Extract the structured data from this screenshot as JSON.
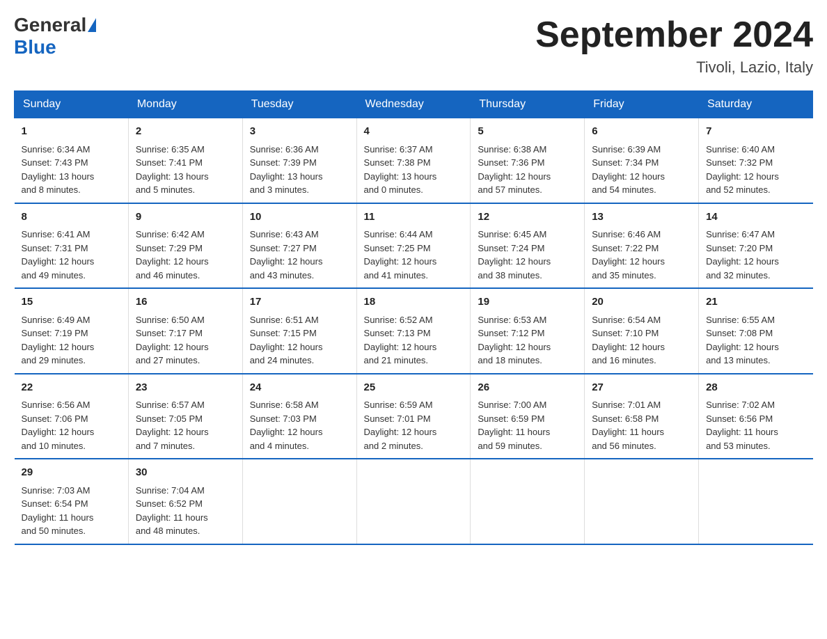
{
  "header": {
    "title": "September 2024",
    "location": "Tivoli, Lazio, Italy",
    "logo_general": "General",
    "logo_blue": "Blue"
  },
  "days_of_week": [
    "Sunday",
    "Monday",
    "Tuesday",
    "Wednesday",
    "Thursday",
    "Friday",
    "Saturday"
  ],
  "weeks": [
    [
      {
        "day": "1",
        "info": "Sunrise: 6:34 AM\nSunset: 7:43 PM\nDaylight: 13 hours\nand 8 minutes."
      },
      {
        "day": "2",
        "info": "Sunrise: 6:35 AM\nSunset: 7:41 PM\nDaylight: 13 hours\nand 5 minutes."
      },
      {
        "day": "3",
        "info": "Sunrise: 6:36 AM\nSunset: 7:39 PM\nDaylight: 13 hours\nand 3 minutes."
      },
      {
        "day": "4",
        "info": "Sunrise: 6:37 AM\nSunset: 7:38 PM\nDaylight: 13 hours\nand 0 minutes."
      },
      {
        "day": "5",
        "info": "Sunrise: 6:38 AM\nSunset: 7:36 PM\nDaylight: 12 hours\nand 57 minutes."
      },
      {
        "day": "6",
        "info": "Sunrise: 6:39 AM\nSunset: 7:34 PM\nDaylight: 12 hours\nand 54 minutes."
      },
      {
        "day": "7",
        "info": "Sunrise: 6:40 AM\nSunset: 7:32 PM\nDaylight: 12 hours\nand 52 minutes."
      }
    ],
    [
      {
        "day": "8",
        "info": "Sunrise: 6:41 AM\nSunset: 7:31 PM\nDaylight: 12 hours\nand 49 minutes."
      },
      {
        "day": "9",
        "info": "Sunrise: 6:42 AM\nSunset: 7:29 PM\nDaylight: 12 hours\nand 46 minutes."
      },
      {
        "day": "10",
        "info": "Sunrise: 6:43 AM\nSunset: 7:27 PM\nDaylight: 12 hours\nand 43 minutes."
      },
      {
        "day": "11",
        "info": "Sunrise: 6:44 AM\nSunset: 7:25 PM\nDaylight: 12 hours\nand 41 minutes."
      },
      {
        "day": "12",
        "info": "Sunrise: 6:45 AM\nSunset: 7:24 PM\nDaylight: 12 hours\nand 38 minutes."
      },
      {
        "day": "13",
        "info": "Sunrise: 6:46 AM\nSunset: 7:22 PM\nDaylight: 12 hours\nand 35 minutes."
      },
      {
        "day": "14",
        "info": "Sunrise: 6:47 AM\nSunset: 7:20 PM\nDaylight: 12 hours\nand 32 minutes."
      }
    ],
    [
      {
        "day": "15",
        "info": "Sunrise: 6:49 AM\nSunset: 7:19 PM\nDaylight: 12 hours\nand 29 minutes."
      },
      {
        "day": "16",
        "info": "Sunrise: 6:50 AM\nSunset: 7:17 PM\nDaylight: 12 hours\nand 27 minutes."
      },
      {
        "day": "17",
        "info": "Sunrise: 6:51 AM\nSunset: 7:15 PM\nDaylight: 12 hours\nand 24 minutes."
      },
      {
        "day": "18",
        "info": "Sunrise: 6:52 AM\nSunset: 7:13 PM\nDaylight: 12 hours\nand 21 minutes."
      },
      {
        "day": "19",
        "info": "Sunrise: 6:53 AM\nSunset: 7:12 PM\nDaylight: 12 hours\nand 18 minutes."
      },
      {
        "day": "20",
        "info": "Sunrise: 6:54 AM\nSunset: 7:10 PM\nDaylight: 12 hours\nand 16 minutes."
      },
      {
        "day": "21",
        "info": "Sunrise: 6:55 AM\nSunset: 7:08 PM\nDaylight: 12 hours\nand 13 minutes."
      }
    ],
    [
      {
        "day": "22",
        "info": "Sunrise: 6:56 AM\nSunset: 7:06 PM\nDaylight: 12 hours\nand 10 minutes."
      },
      {
        "day": "23",
        "info": "Sunrise: 6:57 AM\nSunset: 7:05 PM\nDaylight: 12 hours\nand 7 minutes."
      },
      {
        "day": "24",
        "info": "Sunrise: 6:58 AM\nSunset: 7:03 PM\nDaylight: 12 hours\nand 4 minutes."
      },
      {
        "day": "25",
        "info": "Sunrise: 6:59 AM\nSunset: 7:01 PM\nDaylight: 12 hours\nand 2 minutes."
      },
      {
        "day": "26",
        "info": "Sunrise: 7:00 AM\nSunset: 6:59 PM\nDaylight: 11 hours\nand 59 minutes."
      },
      {
        "day": "27",
        "info": "Sunrise: 7:01 AM\nSunset: 6:58 PM\nDaylight: 11 hours\nand 56 minutes."
      },
      {
        "day": "28",
        "info": "Sunrise: 7:02 AM\nSunset: 6:56 PM\nDaylight: 11 hours\nand 53 minutes."
      }
    ],
    [
      {
        "day": "29",
        "info": "Sunrise: 7:03 AM\nSunset: 6:54 PM\nDaylight: 11 hours\nand 50 minutes."
      },
      {
        "day": "30",
        "info": "Sunrise: 7:04 AM\nSunset: 6:52 PM\nDaylight: 11 hours\nand 48 minutes."
      },
      {
        "day": "",
        "info": ""
      },
      {
        "day": "",
        "info": ""
      },
      {
        "day": "",
        "info": ""
      },
      {
        "day": "",
        "info": ""
      },
      {
        "day": "",
        "info": ""
      }
    ]
  ]
}
